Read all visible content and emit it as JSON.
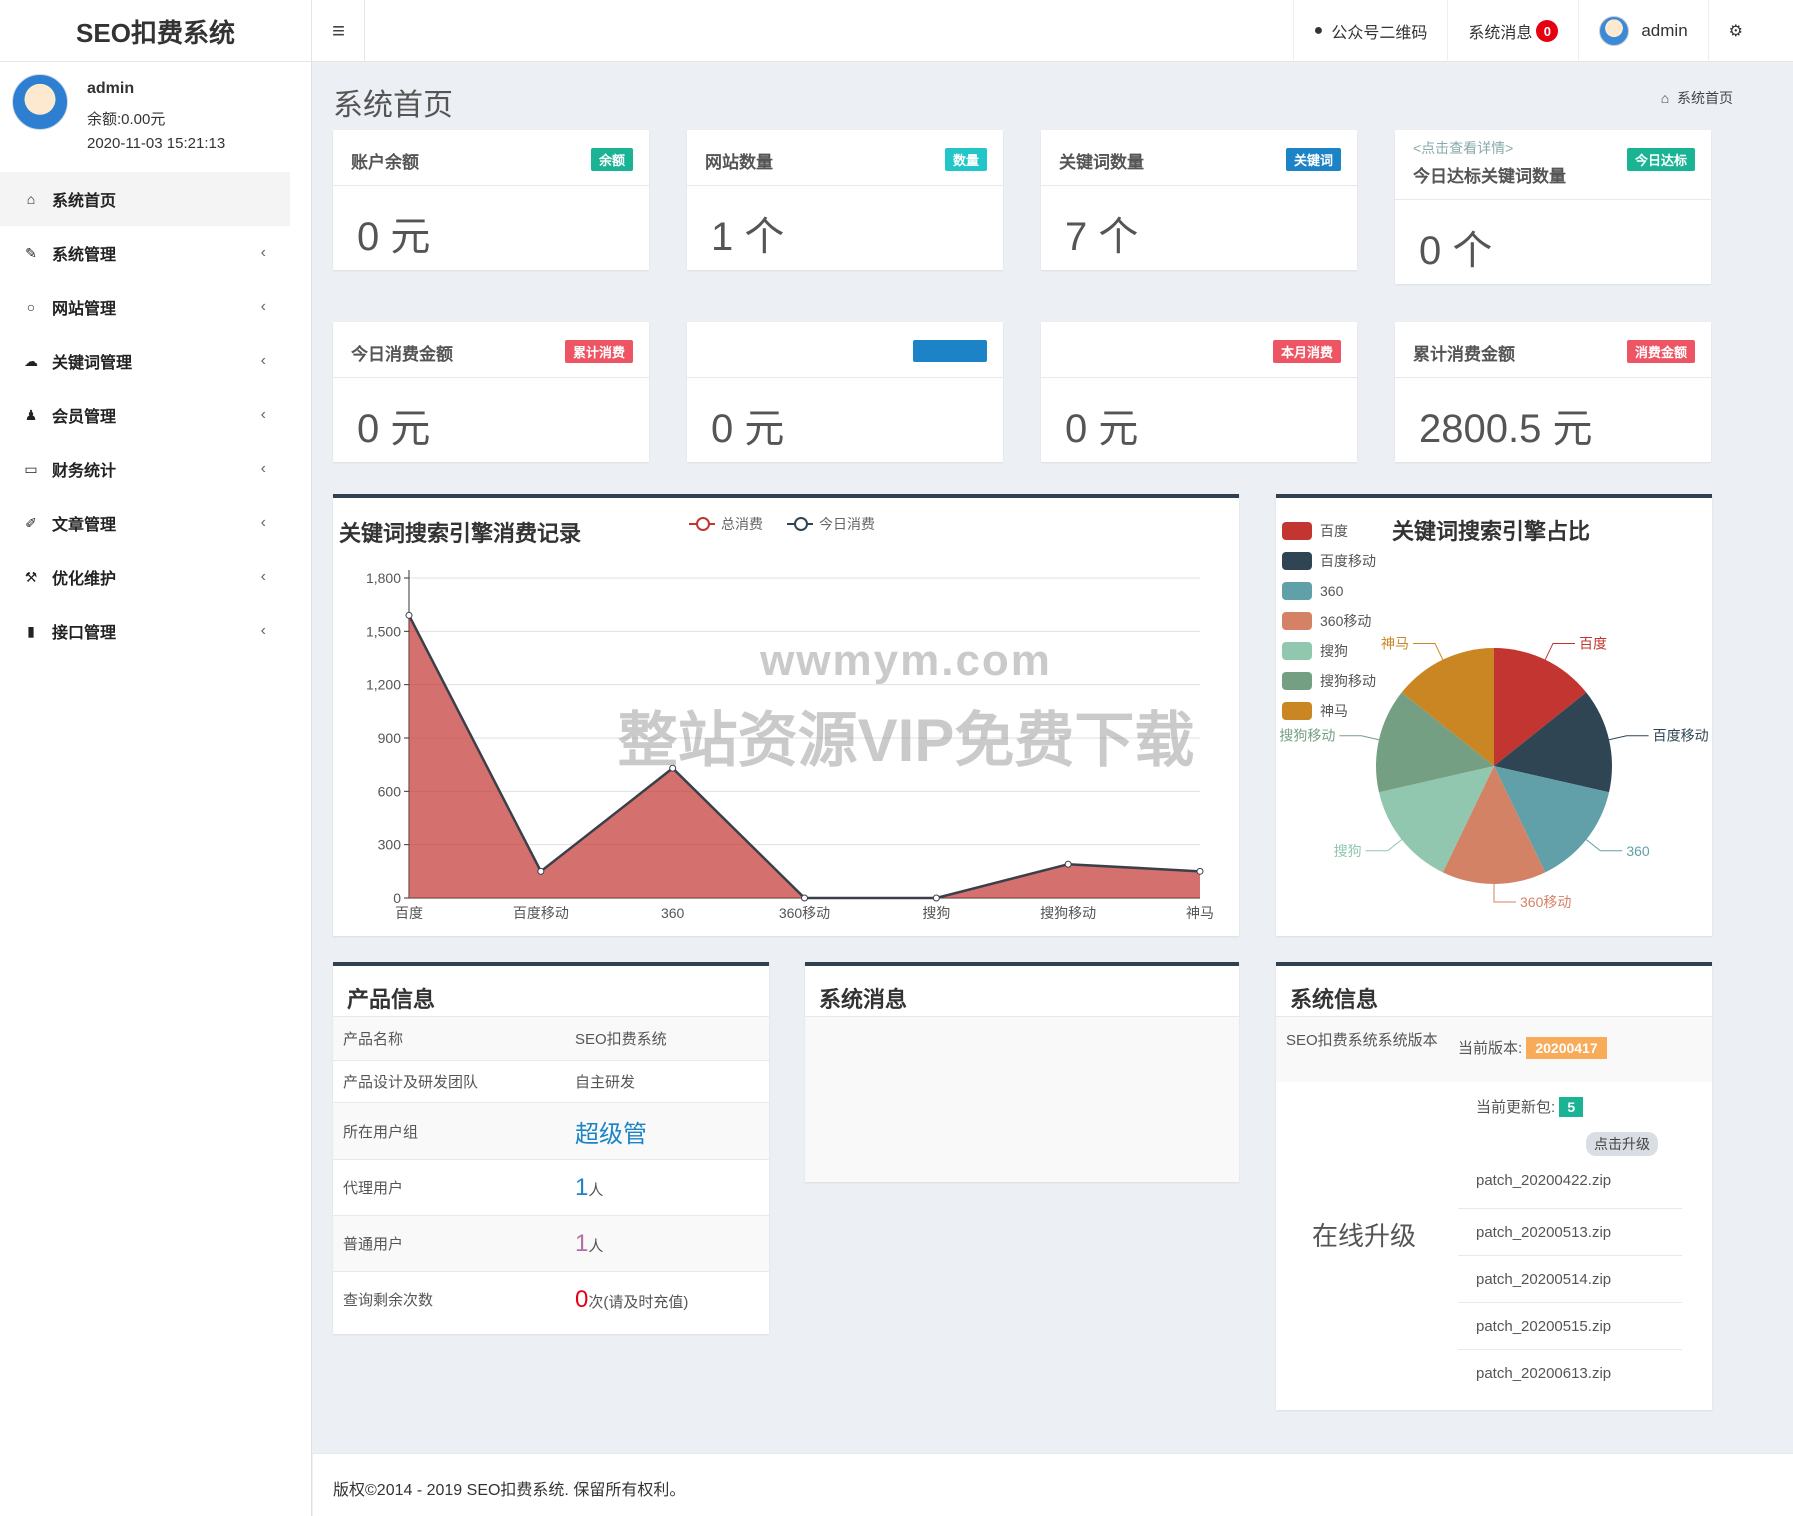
{
  "header": {
    "logo": "SEO扣费系统",
    "hamburger": "≡",
    "nav": {
      "wechat_qr": "公众号二维码",
      "messages": "系统消息",
      "messages_count": "0",
      "user": "admin"
    }
  },
  "sidebar": {
    "user": {
      "name": "admin",
      "balance": "余额:0.00元",
      "time": "2020-11-03 15:21:13"
    },
    "items": [
      {
        "label": "系统首页",
        "icon": "home-icon"
      },
      {
        "label": "系统管理",
        "icon": "wrench-icon"
      },
      {
        "label": "网站管理",
        "icon": "circle-icon"
      },
      {
        "label": "关键词管理",
        "icon": "cloud-icon"
      },
      {
        "label": "会员管理",
        "icon": "users-icon"
      },
      {
        "label": "财务统计",
        "icon": "card-icon"
      },
      {
        "label": "文章管理",
        "icon": "edit-icon"
      },
      {
        "label": "优化维护",
        "icon": "hammer-icon"
      },
      {
        "label": "接口管理",
        "icon": "book-icon"
      }
    ]
  },
  "page": {
    "title": "系统首页",
    "breadcrumb": "系统首页"
  },
  "stats_row1": [
    {
      "title": "账户余额",
      "label": "余额",
      "value": "0 元",
      "color": "#1ab394"
    },
    {
      "title": "网站数量",
      "label": "数量",
      "value": "1 个",
      "color": "#23c6c8"
    },
    {
      "title": "关键词数量",
      "label": "关键词",
      "value": "7 个",
      "color": "#1c84c6"
    },
    {
      "link": "<点击查看详情>",
      "title": "今日达标关键词数量",
      "label": "今日达标",
      "value": "0 个",
      "color": "#1ab394"
    }
  ],
  "stats_row2": [
    {
      "title": "今日消费金额",
      "label": "累计消费",
      "value": "0 元",
      "color": "#ed5565"
    },
    {
      "title": "",
      "label": "",
      "value": "0 元",
      "color": "#1c84c6"
    },
    {
      "title": "",
      "label": "本月消费",
      "value": "0 元",
      "color": "#ed5565"
    },
    {
      "title": "累计消费金额",
      "label": "消费金额",
      "value": "2800.5 元",
      "color": "#ed5565"
    }
  ],
  "chart_data": [
    {
      "type": "area",
      "title": "关键词搜索引擎消费记录",
      "categories": [
        "百度",
        "百度移动",
        "360",
        "360移动",
        "搜狗",
        "搜狗移动",
        "神马"
      ],
      "series": [
        {
          "name": "总消费",
          "values": [
            1590,
            150,
            730,
            0,
            0,
            190,
            150
          ],
          "color": "#c23531"
        },
        {
          "name": "今日消费",
          "values": [
            0,
            0,
            0,
            0,
            0,
            0,
            0
          ],
          "color": "#2f4554"
        }
      ],
      "ylim": [
        0,
        1800
      ],
      "yticks": [
        "0",
        "300",
        "600",
        "900",
        "1,200",
        "1,500",
        "1,800"
      ],
      "grid": true,
      "legend": "top-center"
    },
    {
      "type": "pie",
      "title": "关键词搜索引擎占比",
      "legend": "left",
      "slices": [
        {
          "name": "百度",
          "value": 1,
          "color": "#c23531"
        },
        {
          "name": "百度移动",
          "value": 1,
          "color": "#2f4554"
        },
        {
          "name": "360",
          "value": 1,
          "color": "#61a0a8"
        },
        {
          "name": "360移动",
          "value": 1,
          "color": "#d48265"
        },
        {
          "name": "搜狗",
          "value": 1,
          "color": "#91c7ae"
        },
        {
          "name": "搜狗移动",
          "value": 1,
          "color": "#749f83"
        },
        {
          "name": "神马",
          "value": 1,
          "color": "#ca8622"
        }
      ]
    }
  ],
  "watermark": {
    "line1": "wwmym.com",
    "line2": "整站资源VIP免费下载"
  },
  "product": {
    "title": "产品信息",
    "rows": [
      {
        "k": "产品名称",
        "v": "SEO扣费系统"
      },
      {
        "k": "产品设计及研发团队",
        "v": "自主研发"
      },
      {
        "k": "所在用户组",
        "v": "超级管"
      },
      {
        "k": "代理用户",
        "v": "1",
        "unit": "人"
      },
      {
        "k": "普通用户",
        "v": "1",
        "unit": "人"
      },
      {
        "k": "查询剩余次数",
        "v": "0",
        "unit": "次(请及时充值)"
      }
    ]
  },
  "messages": {
    "title": "系统消息"
  },
  "sysinfo": {
    "title": "系统信息",
    "version_label": "SEO扣费系统系统版本",
    "current_version_label": "当前版本:",
    "current_version": "20200417",
    "update_label": "当前更新包:",
    "update_count": "5",
    "upgrade_btn": "点击升级",
    "online_upgrade": "在线升级",
    "patches": [
      "patch_20200422.zip",
      "patch_20200513.zip",
      "patch_20200514.zip",
      "patch_20200515.zip",
      "patch_20200613.zip"
    ]
  },
  "footer": {
    "text": "版权©2014 - 2019 SEO扣费系统. 保留所有权利。"
  }
}
